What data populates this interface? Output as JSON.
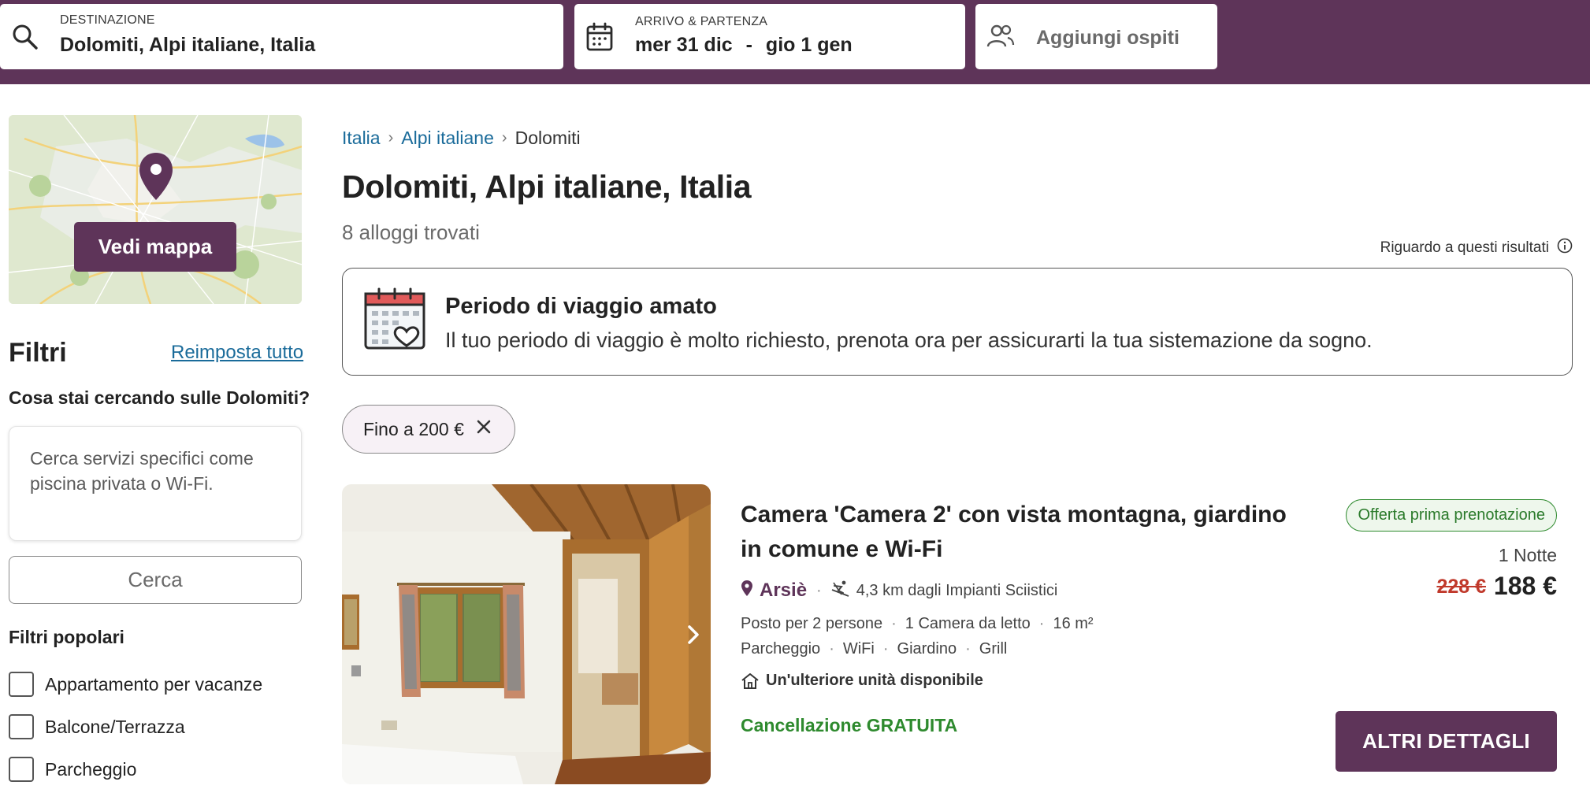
{
  "header": {
    "destination": {
      "label": "DESTINAZIONE",
      "value": "Dolomiti, Alpi italiane, Italia",
      "icon": "search-icon"
    },
    "dates": {
      "label": "ARRIVO & PARTENZA",
      "checkin": "mer 31 dic",
      "separator": "-",
      "checkout": "gio 1 gen",
      "icon": "calendar-icon"
    },
    "guests": {
      "label": "Aggiungi ospiti",
      "icon": "people-icon"
    },
    "colors": {
      "brand": "#5e3459"
    }
  },
  "sidebar": {
    "map_button": "Vedi mappa",
    "filters_title": "Filtri",
    "reset_link": "Reimposta tutto",
    "question": "Cosa stai cercando sulle Dolomiti?",
    "search_placeholder": "Cerca servizi specifici come piscina privata o Wi-Fi.",
    "search_button": "Cerca",
    "popular_title": "Filtri popolari",
    "popular": [
      {
        "label": "Appartamento per vacanze",
        "checked": false
      },
      {
        "label": "Balcone/Terrazza",
        "checked": false
      },
      {
        "label": "Parcheggio",
        "checked": false
      }
    ]
  },
  "main": {
    "breadcrumb": [
      "Italia",
      "Alpi italiane",
      "Dolomiti"
    ],
    "title": "Dolomiti, Alpi italiane, Italia",
    "count": "8 alloggi trovati",
    "about_results": "Riguardo a questi risultati",
    "promo": {
      "title": "Periodo di viaggio amato",
      "text": "Il tuo periodo di viaggio è molto richiesto, prenota ora per assicurarti la tua sistemazione da sogno."
    },
    "active_filter": "Fino a 200 €"
  },
  "listing": {
    "title": "Camera 'Camera 2' con vista montagna, giardino in comune e Wi-Fi",
    "badge": "Offerta prima prenotazione",
    "nights": "1 Notte",
    "old_price": "228 €",
    "price": "188 €",
    "location": "Arsiè",
    "distance": "4,3 km dagli Impianti Sciistici",
    "specs": [
      "Posto per 2 persone",
      "1 Camera da letto",
      "16 m²"
    ],
    "amenities": [
      "Parcheggio",
      "WiFi",
      "Giardino",
      "Grill"
    ],
    "availability": "Un'ulteriore unità disponibile",
    "cancellation": "Cancellazione GRATUITA",
    "details_button": "ALTRI DETTAGLI"
  }
}
